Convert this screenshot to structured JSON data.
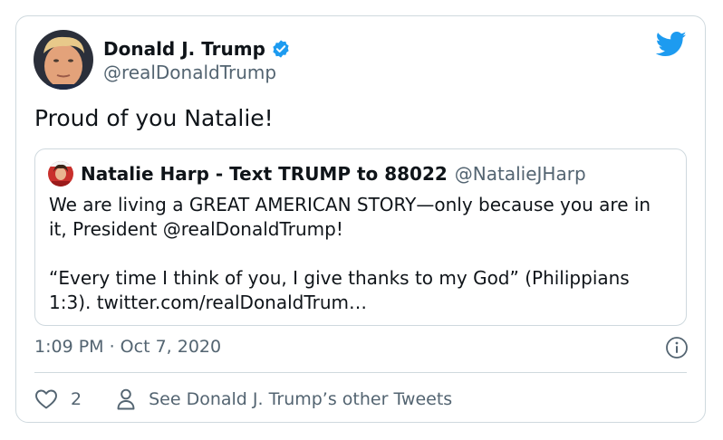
{
  "tweet": {
    "author": {
      "name": "Donald J. Trump",
      "handle": "@realDonaldTrump",
      "verified": true,
      "avatar_icon": "profile-photo"
    },
    "text": "Proud of you Natalie!",
    "quoted_tweet": {
      "author": {
        "name": "Natalie Harp - Text TRUMP to 88022",
        "handle": "@NatalieJHarp",
        "avatar_icon": "profile-photo"
      },
      "paragraph_1": "We are living a GREAT AMERICAN STORY—only because you are in it, President @realDonaldTrump!",
      "paragraph_2": "“Every time I think of you, I give thanks to my God” (Philippians 1:3). twitter.com/realDonaldTrum…"
    },
    "timestamp": "1:09 PM · Oct 7, 2020",
    "actions": {
      "like_count": "2",
      "profile_link_label": "See Donald J. Trump’s other Tweets"
    }
  },
  "colors": {
    "brand_blue": "#1d9bf0",
    "text_primary": "#0f1419",
    "text_secondary": "#536471",
    "border": "#cfd9de"
  },
  "icons": [
    "verified-badge-icon",
    "twitter-bird-icon",
    "info-icon",
    "heart-icon",
    "person-icon"
  ]
}
